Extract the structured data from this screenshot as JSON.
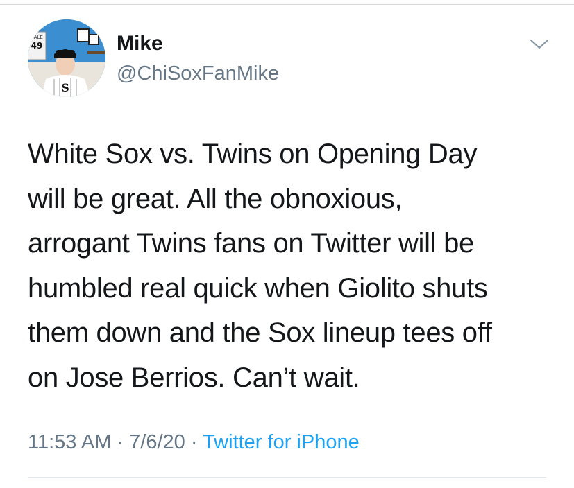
{
  "user": {
    "display_name": "Mike",
    "handle": "@ChiSoxFanMike"
  },
  "tweet": {
    "lines": [
      "White Sox vs. Twins on Opening Day",
      "will be great. All the obnoxious,",
      "arrogant Twins fans on Twitter will be",
      "humbled real quick when Giolito shuts",
      "them down and the Sox lineup tees off",
      "on Jose Berrios. Can’t wait."
    ],
    "time": "11:53 AM",
    "separator": " · ",
    "date": "7/6/20",
    "source": "Twitter for iPhone"
  },
  "avatar": {
    "jersey_number": "49",
    "sign_text": "SALE"
  },
  "icons": {
    "menu": "chevron-down-icon"
  },
  "colors": {
    "text": "#14171a",
    "secondary": "#657786",
    "link": "#1da1f2",
    "divider": "#e1e8ed"
  }
}
